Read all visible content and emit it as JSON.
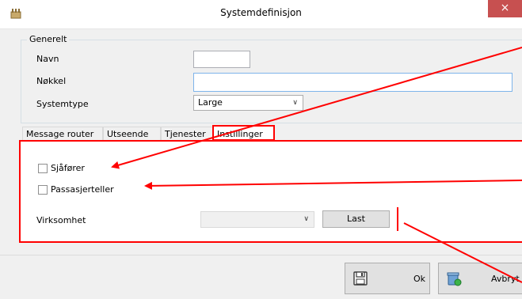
{
  "window": {
    "title": "Systemdefinisjon",
    "close_glyph": "×",
    "accent_close": "#c75050"
  },
  "general": {
    "group_label": "Generelt",
    "name_label": "Navn",
    "name_value": "",
    "key_label": "Nøkkel",
    "key_value": "",
    "systemtype_label": "Systemtype",
    "systemtype_value": "Large"
  },
  "tabs": [
    {
      "label": "Message router",
      "active": false
    },
    {
      "label": "Utseende",
      "active": false
    },
    {
      "label": "Tjenester",
      "active": false
    },
    {
      "label": "Instillinger",
      "active": true
    }
  ],
  "settings": {
    "driver_label": "Sjåfører",
    "driver_checked": false,
    "counter_label": "Passasjerteller",
    "counter_checked": false,
    "business_label": "Virksomhet",
    "business_value": "",
    "load_button": "Last"
  },
  "footer": {
    "ok_button": "Ok",
    "cancel_button": "Avbryt",
    "ok_icon": "floppy-disk-icon",
    "cancel_icon": "recycle-bin-icon"
  },
  "annotation_color": "#ff0000"
}
